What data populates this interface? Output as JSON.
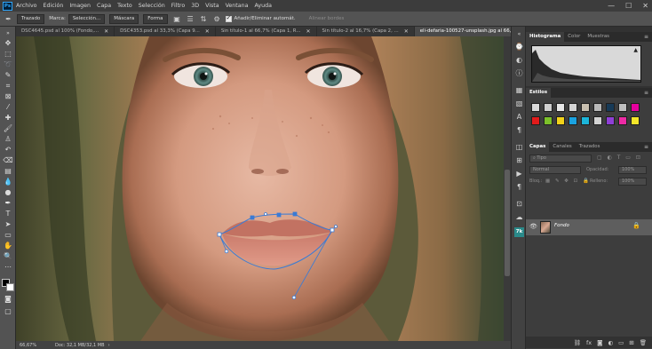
{
  "app": {
    "logo_text": "Ps"
  },
  "menu": [
    "Archivo",
    "Edición",
    "Imagen",
    "Capa",
    "Texto",
    "Selección",
    "Filtro",
    "3D",
    "Vista",
    "Ventana",
    "Ayuda"
  ],
  "window_controls": {
    "minimize": "—",
    "maximize": "☐",
    "close": "✕"
  },
  "options_bar": {
    "mode_label": "Trazado",
    "make_label": "Marca:",
    "selection_button": "Selección...",
    "mask_button": "Máscara",
    "shape_button": "Forma",
    "auto_add_delete_label": "Añadir/Eliminar automát.",
    "align_edges_label": "Alinear bordes"
  },
  "tabs": [
    {
      "label": "DSC4645.psd al 100% (Fondo,...",
      "active": false
    },
    {
      "label": "DSC4353.psd al 33,3% (Capa 9...",
      "active": false
    },
    {
      "label": "Sin título-1 al 66,7% (Capa 1, R...",
      "active": false
    },
    {
      "label": "Sin título-2 al 16,7% (Capa 2, ...",
      "active": false
    },
    {
      "label": "eli-defaria-100527-unsplash.jpg al 66,7% (RGB/8*)",
      "active": true
    }
  ],
  "tab_close_glyph": "✕",
  "status_bar": {
    "zoom": "66,67%",
    "doc": "Doc: 32,1 MB/32,1 MB"
  },
  "panels": {
    "histogram": {
      "tabs": [
        "Histograma",
        "Color",
        "Muestras"
      ],
      "warning_glyph": "▲"
    },
    "styles": {
      "title": "Estilos",
      "swatches": [
        "#d9d9d9",
        "#cfcfcf",
        "#e8e8e8",
        "#d6d6d6",
        "#c9c0b0",
        "#b9b9b9",
        "#173a57",
        "#bfbfbf",
        "#e6009e",
        "#e21b1b",
        "#7cc12a",
        "#f2d21a",
        "#1aa2e0",
        "#1cb5d9",
        "#d3d3d3",
        "#8f3fd6",
        "#ee2aa5",
        "#f5e62a"
      ]
    },
    "layers": {
      "tabs": [
        "Capas",
        "Canales",
        "Trazados"
      ],
      "kind_placeholder": "Tipo",
      "blend_mode": "Normal",
      "opacity_label": "Opacidad:",
      "opacity_value": "100%",
      "lock_label": "Bloq.:",
      "fill_label": "Relleno:",
      "fill_value": "100%",
      "layer_name": "Fondo"
    }
  },
  "colors": {
    "accent": "#31a8ff",
    "app_bg": "#535353",
    "panel_bg": "#323232"
  }
}
